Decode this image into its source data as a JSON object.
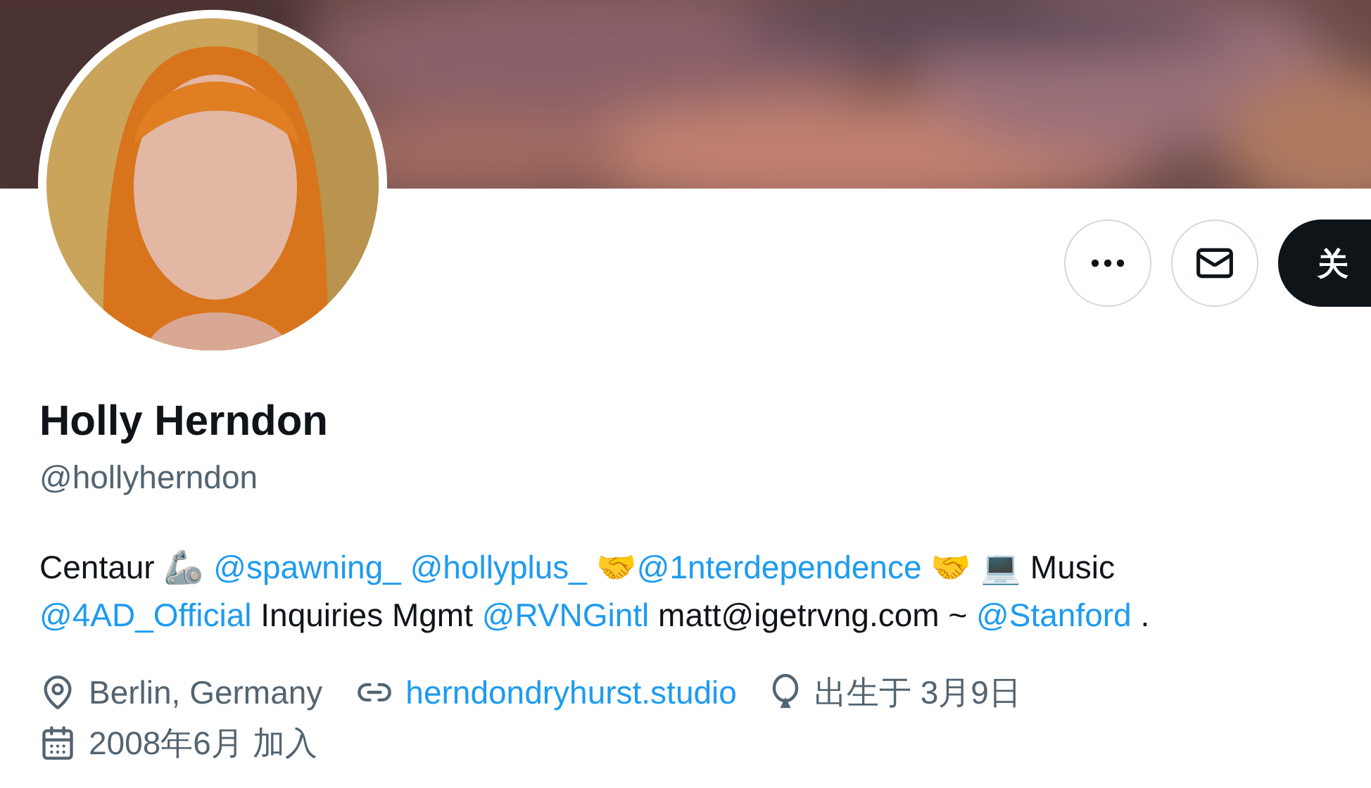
{
  "actions": [
    {
      "kind": "more"
    },
    {
      "kind": "message"
    },
    {
      "kind": "follow",
      "label": "关"
    }
  ],
  "profile": {
    "name": "Holly Herndon",
    "handle": "@hollyherndon"
  },
  "bio_lines": [
    [
      {
        "kind": "text",
        "text": "Centaur 🦾 "
      },
      {
        "kind": "link",
        "text": "@spawning_"
      },
      {
        "kind": "link",
        "text": "@hollyplus_"
      },
      {
        "kind": "text",
        "text": " 🤝"
      },
      {
        "kind": "link",
        "text": "@1nterdependence"
      },
      {
        "kind": "text",
        "text": " 🤝 💻 Music"
      }
    ],
    [
      {
        "kind": "link",
        "text": "@4AD_Official"
      },
      {
        "kind": "text",
        "text": " Inquiries Mgmt "
      },
      {
        "kind": "link",
        "text": "@RVNGintl"
      },
      {
        "kind": "text",
        "text": " matt@igetrvng.com ~ "
      },
      {
        "kind": "link",
        "text": "@Stanford"
      },
      {
        "kind": "text",
        "text": " ."
      }
    ]
  ],
  "meta": [
    {
      "kind": "location",
      "text": "Berlin, Germany"
    },
    {
      "kind": "website",
      "text": "herndondryhurst.studio"
    },
    {
      "kind": "birthday",
      "text": "出生于 3月9日"
    },
    {
      "kind": "joined",
      "text": "2008年6月 加入"
    }
  ]
}
